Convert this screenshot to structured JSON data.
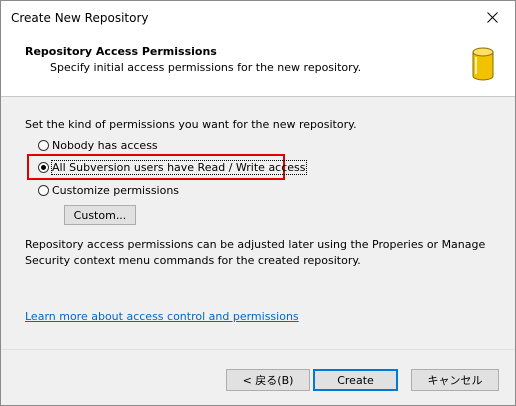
{
  "window": {
    "title": "Create New Repository",
    "close_icon": "close-icon"
  },
  "header": {
    "title": "Repository Access Permissions",
    "subtitle": "Specify initial access permissions for the new repository.",
    "icon": "database-icon",
    "icon_color": "#f2c200"
  },
  "body": {
    "intro": "Set the kind of permissions you want for the new repository.",
    "options": [
      {
        "label": "Nobody has access",
        "checked": false
      },
      {
        "label": "All Subversion users have Read / Write access",
        "checked": true
      },
      {
        "label": "Customize permissions",
        "checked": false
      }
    ],
    "custom_button": "Custom...",
    "description": "Repository access permissions can be adjusted later using the Properies or Manage Security context menu commands for the created repository.",
    "link": "Learn more about access control and permissions",
    "highlight_color": "#e00000"
  },
  "footer": {
    "back_label": "< 戻る(B)",
    "create_label": "Create",
    "cancel_label": "キャンセル"
  }
}
